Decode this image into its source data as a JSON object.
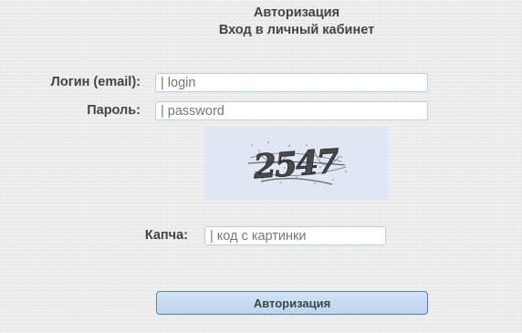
{
  "header": {
    "title": "Авторизация",
    "subtitle": "Вход в личный кабинет"
  },
  "form": {
    "login": {
      "label": "Логин (email):",
      "value": "",
      "placeholder": "| login"
    },
    "password": {
      "label": "Пароль:",
      "value": "",
      "placeholder": "| password"
    },
    "captcha": {
      "text": "2547",
      "label": "Капча:",
      "value": "",
      "placeholder": "| код с картинки"
    },
    "submit_label": "Авторизация"
  },
  "colors": {
    "background": "#ececec",
    "input_border": "#b7cfe3",
    "captcha_background": "#dee7f3",
    "button_fill": "#c9dcf0",
    "button_border": "#5a7ea5",
    "text": "#444444"
  }
}
